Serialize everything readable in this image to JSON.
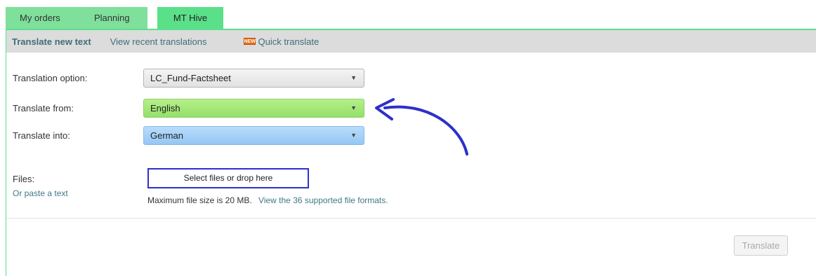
{
  "tabs": {
    "my_orders": "My orders",
    "planning": "Planning",
    "mt_hive": "MT Hive"
  },
  "subnav": {
    "translate_new": "Translate new text",
    "recent": "View recent translations",
    "new_badge": "NEW",
    "quick": "Quick translate"
  },
  "form": {
    "option_label": "Translation option:",
    "option_value": "LC_Fund-Factsheet",
    "from_label": "Translate from:",
    "from_value": "English",
    "into_label": "Translate into:",
    "into_value": "German",
    "files_label": "Files:",
    "paste_link": "Or paste a text",
    "select_files": "Select files or drop here",
    "max_size": "Maximum file size is 20 MB.",
    "formats_link": "View the 36 supported file formats.",
    "arrow": "▼"
  },
  "actions": {
    "translate": "Translate"
  },
  "colors": {
    "tab_green": "#7ee09b",
    "from_green": "#93e06a",
    "into_blue": "#94c7f4",
    "annotation_blue": "#2c31c9"
  },
  "icons": {
    "annotation": "curved-arrow-icon",
    "dropdown": "chevron-down-icon"
  }
}
